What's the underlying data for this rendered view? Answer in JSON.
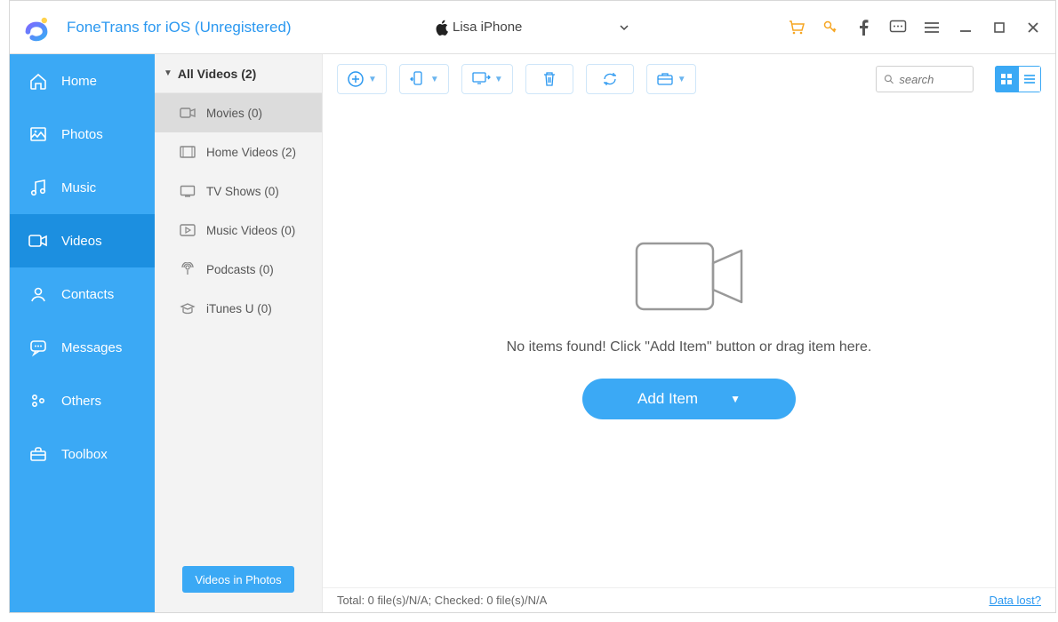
{
  "app": {
    "title": "FoneTrans for iOS (Unregistered)"
  },
  "device": {
    "name": "Lisa iPhone"
  },
  "sidebar": {
    "items": [
      {
        "label": "Home"
      },
      {
        "label": "Photos"
      },
      {
        "label": "Music"
      },
      {
        "label": "Videos"
      },
      {
        "label": "Contacts"
      },
      {
        "label": "Messages"
      },
      {
        "label": "Others"
      },
      {
        "label": "Toolbox"
      }
    ]
  },
  "subpanel": {
    "header": "All Videos (2)",
    "items": [
      {
        "label": "Movies (0)"
      },
      {
        "label": "Home Videos (2)"
      },
      {
        "label": "TV Shows (0)"
      },
      {
        "label": "Music Videos (0)"
      },
      {
        "label": "Podcasts (0)"
      },
      {
        "label": "iTunes U (0)"
      }
    ],
    "footer_button": "Videos in Photos"
  },
  "search": {
    "placeholder": "search"
  },
  "empty": {
    "message": "No items found! Click \"Add Item\" button or drag item here.",
    "button": "Add Item"
  },
  "statusbar": {
    "text": "Total: 0 file(s)/N/A; Checked: 0 file(s)/N/A",
    "link": "Data lost?"
  }
}
